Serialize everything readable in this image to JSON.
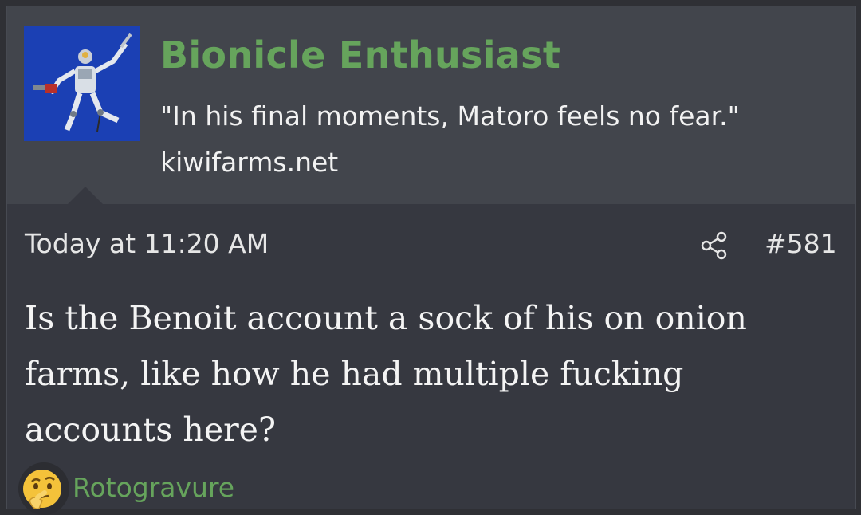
{
  "user": {
    "avatar_icon": "bionicle-figure-avatar",
    "name": "Bionicle Enthusiast",
    "title": "\"In his final moments, Matoro feels no fear.\"",
    "site": "kiwifarms.net",
    "name_color": "#66a45c"
  },
  "post": {
    "date": "Today at 11:20 AM",
    "share_icon": "share-icon",
    "number": "#581",
    "message": "Is the Benoit account a sock of his on onion farms, like how he had multiple fucking accounts here?"
  },
  "reaction": {
    "emoji_icon": "thinking-face-icon",
    "username": "Rotogravure"
  }
}
